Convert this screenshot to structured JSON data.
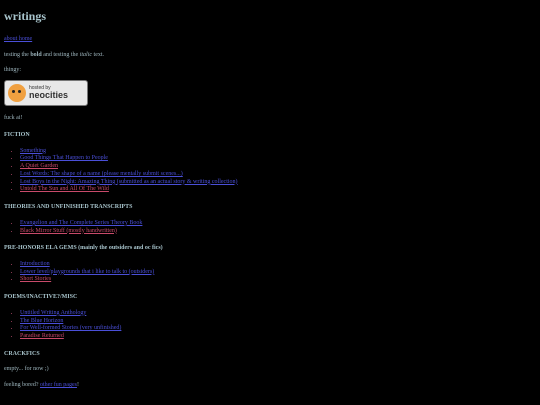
{
  "header": {
    "title": "writings"
  },
  "intro": {
    "home_link": "about home",
    "test_prefix": "testing the ",
    "bold_word": "bold",
    "test_middle": " and testing the ",
    "italic_word": "italic",
    "test_suffix": " text.",
    "thingy_label": "thingy:",
    "badge_small": "hosted by",
    "badge_big": "neocities",
    "fuck_ai": "fuck ai!"
  },
  "sections": {
    "fiction": {
      "title": "FICTION",
      "items": [
        "Something",
        "Good Things That Happen to People",
        "A Quiet Garden",
        "Lost Words: The shape of a name (please mentally submit scenes...)",
        "Lost Boys in the Night: Amazing Thing (submitted as an actual story & writing collection)",
        "Untold The Sun and All Of The Wild"
      ]
    },
    "theories": {
      "title": "THEORIES AND UNFINISHED TRANSCRIPTS",
      "items": [
        "Evangelion and The Complete Series Theory Book",
        "Black Mirror Stuff (mostly handwritten)"
      ]
    },
    "preHonors": {
      "title": "PRE-HONORS ELA GEMS (mainly the outsiders and oc fics)",
      "items": [
        "Introduction",
        "Lower level/playgrounds that i like to talk to (outsiders)",
        "Short Stories"
      ]
    },
    "poems": {
      "title": "POEMS/INACTIVE?/MISC",
      "items": [
        "Untitled Writing Anthology",
        "The Blue Horizon",
        "For Well-formed Stories (very unfinished)",
        "Paradise Returned"
      ]
    },
    "crackfics": {
      "title": "CRACKFICS",
      "empty_text": "empty... for now ;)"
    }
  },
  "footer": {
    "prefix": "feeling bored? ",
    "link": "other fun pages",
    "suffix": "!"
  }
}
